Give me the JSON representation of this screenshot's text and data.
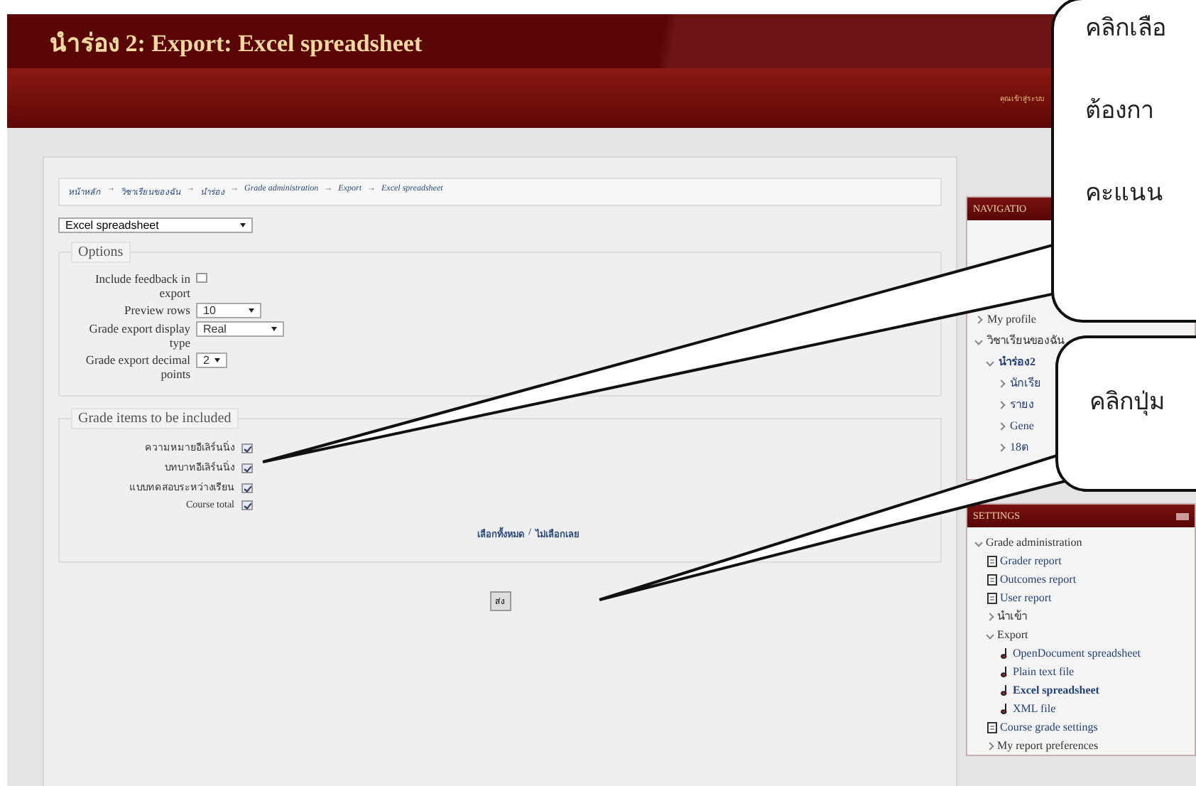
{
  "header": {
    "title": "นำร่อง 2: Export: Excel spreadsheet",
    "login_info": "คุณเข้าสู่ระบบ"
  },
  "breadcrumb_separator": "→",
  "breadcrumb": [
    "หน้าหลัก",
    "วิชาเรียนของฉัน",
    "นำร่อง",
    "Grade administration",
    "Export",
    "Excel spreadsheet"
  ],
  "export_format": {
    "value": "Excel spreadsheet"
  },
  "options": {
    "legend": "Options",
    "fields": [
      {
        "kind": "checkbox",
        "label": "Include feedback in export",
        "checked": false
      },
      {
        "kind": "select",
        "label": "Preview rows",
        "value": "10"
      },
      {
        "kind": "select",
        "label": "Grade export display type",
        "value": "Real"
      },
      {
        "kind": "select",
        "label": "Grade export decimal points",
        "value": "2"
      }
    ]
  },
  "grade_items": {
    "legend": "Grade items to be included",
    "items": [
      {
        "label": "ความหมายอีเลิร์นนิ่ง",
        "checked": true
      },
      {
        "label": "บทบาทอีเลิร์นนิ่ง",
        "checked": true
      },
      {
        "label": "แบบทดสอบระหว่างเรียน",
        "checked": true
      },
      {
        "label": "Course total",
        "checked": true
      }
    ],
    "select_all": "เลือกทั้งหมด",
    "separator": "/",
    "select_none": "ไม่เลือกเลย"
  },
  "submit_button": "ส่ง",
  "navigation": {
    "title": "NAVIGATIO",
    "items": [
      {
        "label": "My profile",
        "kind": "text",
        "expanded": false
      },
      {
        "label": "วิชาเรียนของฉัน",
        "kind": "text",
        "expanded": true,
        "children": [
          {
            "label": "นำร่อง2",
            "kind": "link",
            "expanded": true,
            "children": [
              {
                "label": "นักเรีย",
                "kind": "link",
                "expanded": false
              },
              {
                "label": "รายง",
                "kind": "link",
                "expanded": false
              },
              {
                "label": "Gene",
                "kind": "link",
                "expanded": false
              },
              {
                "label": "18ต",
                "kind": "link",
                "expanded": false
              }
            ]
          }
        ]
      }
    ]
  },
  "settings": {
    "title": "SETTINGS",
    "items": [
      {
        "label": "Grade administration",
        "kind": "branch",
        "expanded": true,
        "children": [
          {
            "label": "Grader report",
            "kind": "report"
          },
          {
            "label": "Outcomes report",
            "kind": "report"
          },
          {
            "label": "User report",
            "kind": "report"
          },
          {
            "label": "นำเข้า",
            "kind": "branch",
            "expanded": false
          },
          {
            "label": "Export",
            "kind": "branch",
            "expanded": true,
            "children": [
              {
                "label": "OpenDocument spreadsheet",
                "kind": "tool",
                "selected": false
              },
              {
                "label": "Plain text file",
                "kind": "tool",
                "selected": false
              },
              {
                "label": "Excel spreadsheet",
                "kind": "tool",
                "selected": true
              },
              {
                "label": "XML file",
                "kind": "tool",
                "selected": false
              }
            ]
          },
          {
            "label": "Course grade settings",
            "kind": "report"
          },
          {
            "label": "My report preferences",
            "kind": "branch",
            "expanded": false
          }
        ]
      }
    ]
  },
  "callouts": [
    {
      "lines": [
        "คลิกเลือ",
        "ต้องกา",
        "คะแนน"
      ]
    },
    {
      "lines": [
        "คลิกปุ่ม"
      ]
    }
  ]
}
